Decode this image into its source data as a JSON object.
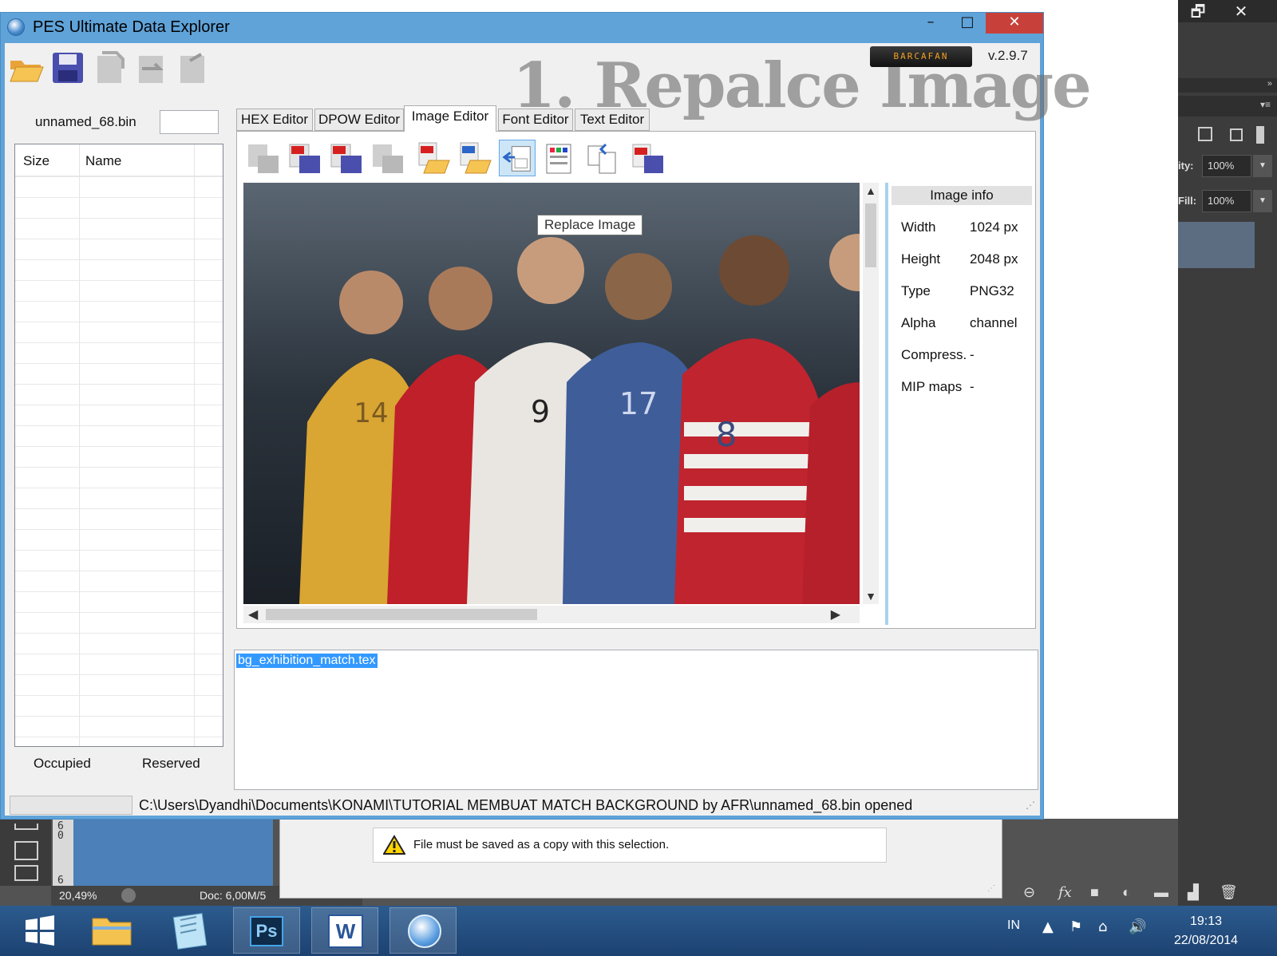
{
  "pes_window": {
    "title": "PES Ultimate Data Explorer",
    "minimize": "–",
    "maximize": "□",
    "close": "✕",
    "brand": "BARCAFAN",
    "version": "v.2.9.7",
    "watermark": "1. Repalce Image",
    "file_name": "unnamed_68.bin",
    "file_search_value": "",
    "file_list": {
      "columns": [
        "Size",
        "Name"
      ],
      "rows": []
    },
    "occupied_label": "Occupied",
    "reserved_label": "Reserved",
    "tabs": [
      {
        "label": "HEX Editor",
        "active": false
      },
      {
        "label": "DPOW Editor",
        "active": false
      },
      {
        "label": "Image Editor",
        "active": true
      },
      {
        "label": "Font Editor",
        "active": false
      },
      {
        "label": "Text Editor",
        "active": false
      }
    ],
    "tooltip": "Replace Image",
    "image_info": {
      "title": "Image info",
      "rows": [
        {
          "key": "Width",
          "value": "1024 px"
        },
        {
          "key": "Height",
          "value": "2048 px"
        },
        {
          "key": "Type",
          "value": "PNG32"
        },
        {
          "key": "Alpha",
          "value": "channel"
        },
        {
          "key": "Compress.",
          "value": "-"
        },
        {
          "key": "MIP maps",
          "value": "-"
        }
      ]
    },
    "selected_text": "bg_exhibition_match.tex",
    "status_path": "C:\\Users\\Dyandhi\\Documents\\KONAMI\\TUTORIAL MEMBUAT MATCH BACKGROUND by AFR\\unnamed_68.bin opened",
    "jersey_numbers": [
      "14",
      "9",
      "17",
      "8"
    ],
    "colors": {
      "title_bar": "#5fa3d9",
      "close": "#c7413a",
      "selection": "#3399ff"
    }
  },
  "photoshop": {
    "opacity_label": "ity:",
    "opacity_value": "100%",
    "fill_label": "Fill:",
    "fill_value": "100%",
    "zoom": "20,49%",
    "doc_info": "Doc: 6,00M/5",
    "ruler_text": "6 0",
    "ruler_text_2": "6",
    "dialog_message": "File must be saved as a copy with this selection.",
    "restore_button": "🗗",
    "close_button": "✕"
  },
  "taskbar": {
    "language": "IN",
    "time": "19:13",
    "date": "22/08/2014",
    "apps": [
      "start",
      "file-explorer",
      "notepad",
      "photoshop",
      "word",
      "pes-explorer"
    ],
    "ps_label": "Ps",
    "word_label": "W"
  }
}
